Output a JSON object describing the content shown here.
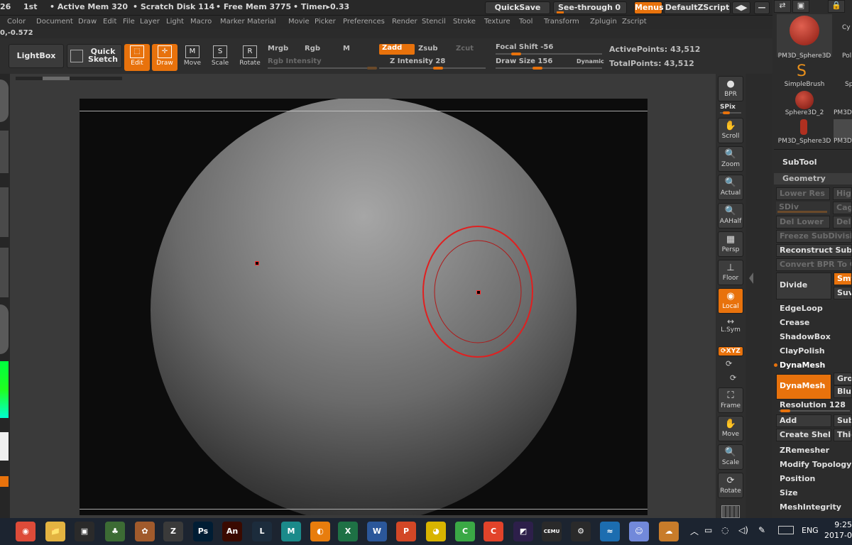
{
  "infobar": {
    "first": "26",
    "first2": "1st",
    "active_mem": "• Active Mem 320",
    "scratch_disk": "• Scratch Disk 114",
    "free_mem": "• Free Mem 3775",
    "timer": "• Timer▸0.33",
    "quicksave": "QuickSave",
    "see_through": "See-through",
    "see_through_value": "0",
    "menus": "Menus",
    "default_zscript": "DefaultZScript"
  },
  "menu": [
    "Color",
    "Document",
    "Draw",
    "Edit",
    "File",
    "Layer",
    "Light",
    "Macro",
    "Marker",
    "Material",
    "Movie",
    "Picker",
    "Preferences",
    "Render",
    "Stencil",
    "Stroke",
    "Texture",
    "Tool",
    "Transform",
    "Zplugin",
    "Zscript"
  ],
  "coords": "0,-0.572",
  "toolbar": {
    "lightbox": "LightBox",
    "quick_sketch": "Quick Sketch",
    "tools": [
      {
        "label": "Edit",
        "glyph": "⬚",
        "active": true
      },
      {
        "label": "Draw",
        "glyph": "✛",
        "active": true
      },
      {
        "label": "Move",
        "glyph": "M",
        "active": false
      },
      {
        "label": "Scale",
        "glyph": "S",
        "active": false
      },
      {
        "label": "Rotate",
        "glyph": "R",
        "active": false
      }
    ],
    "mrgb": "Mrgb",
    "rgb": "Rgb",
    "m": "M",
    "rgb_intensity": "Rgb Intensity",
    "zadd": "Zadd",
    "zsub": "Zsub",
    "zcut": "Zcut",
    "z_intensity": "Z Intensity 28",
    "focal_shift": "Focal Shift -56",
    "draw_size": "Draw Size 156",
    "dynamic": "Dynamic",
    "active_points": "ActivePoints: 43,512",
    "total_points": "TotalPoints: 43,512"
  },
  "right_tools": [
    {
      "label": "BPR",
      "glyph": "●",
      "active": false
    },
    {
      "label": "Scroll",
      "glyph": "✋",
      "active": false
    },
    {
      "label": "Zoom",
      "glyph": "🔍",
      "active": false
    },
    {
      "label": "Actual",
      "glyph": "🔍",
      "active": false
    },
    {
      "label": "AAHalf",
      "glyph": "🔍",
      "active": false
    },
    {
      "label": "Persp",
      "glyph": "▦",
      "active": false
    },
    {
      "label": "Floor",
      "glyph": "⊥",
      "active": false
    },
    {
      "label": "Local",
      "glyph": "◉",
      "active": true
    },
    {
      "label": "L.Sym",
      "glyph": "↔",
      "active": false
    },
    {
      "label": "Frame",
      "glyph": "⛶",
      "active": false
    },
    {
      "label": "Move",
      "glyph": "✋",
      "active": false
    },
    {
      "label": "Scale",
      "glyph": "🔍",
      "active": false
    },
    {
      "label": "Rotate",
      "glyph": "⟳",
      "active": false
    }
  ],
  "spix": "SPix",
  "xyz": "⟳XYZ",
  "right_panel": {
    "thumbs": [
      "PM3D_Sphere3D",
      "SimpleBrush",
      "Sphere3D_2",
      "PM3D_Sphere3D"
    ],
    "side_thumbs": [
      "Cy",
      "Pol",
      "Sp",
      "PM3D",
      "PM3D"
    ],
    "subtool": "SubTool",
    "geometry": "Geometry",
    "lower_res": "Lower Res",
    "higher": "High",
    "sdiv": "SDiv",
    "cage": "Cage",
    "del_lower": "Del Lower",
    "del": "Del",
    "freeze": "Freeze SubDivision",
    "reconstruct": "Reconstruct Subdiv",
    "convert_bpr": "Convert BPR To Geo",
    "divide": "Divide",
    "smt": "Smt",
    "suv": "Suv",
    "edgeloop": "EdgeLoop",
    "crease": "Crease",
    "shadowbox": "ShadowBox",
    "claypolish": "ClayPolish",
    "dynamesh_header": "DynaMesh",
    "dynamesh_btn": "DynaMesh",
    "groups": "Grou",
    "blur": "Blur",
    "resolution": "Resolution 128",
    "add": "Add",
    "sub": "Sub",
    "create_shell": "Create Shell",
    "thick": "Thic",
    "zremesher": "ZRemesher",
    "modify_topology": "Modify Topology",
    "position": "Position",
    "size": "Size",
    "meshintegrity": "MeshIntegrity"
  },
  "taskbar": {
    "apps": [
      {
        "name": "chrome-icon",
        "glyph": "◉",
        "color": "#dd4b39"
      },
      {
        "name": "file-explorer-icon",
        "glyph": "📁",
        "color": "#e3b341"
      },
      {
        "name": "media-icon",
        "glyph": "▣",
        "color": "#2a2a2a"
      },
      {
        "name": "game1-icon",
        "glyph": "♣",
        "color": "#3c6b34"
      },
      {
        "name": "game2-icon",
        "glyph": "✿",
        "color": "#a05a2c"
      },
      {
        "name": "zbrush-icon",
        "glyph": "Z",
        "color": "#3a3a3a"
      },
      {
        "name": "photoshop-icon",
        "glyph": "Ps",
        "color": "#001d34"
      },
      {
        "name": "animate-icon",
        "glyph": "An",
        "color": "#3a0a00"
      },
      {
        "name": "league-icon",
        "glyph": "L",
        "color": "#1c2c3c"
      },
      {
        "name": "maya-icon",
        "glyph": "M",
        "color": "#1b8a8a"
      },
      {
        "name": "blender-icon",
        "glyph": "◐",
        "color": "#e87d0d"
      },
      {
        "name": "excel-icon",
        "glyph": "X",
        "color": "#1e7145"
      },
      {
        "name": "word-icon",
        "glyph": "W",
        "color": "#2b579a"
      },
      {
        "name": "powerpoint-icon",
        "glyph": "P",
        "color": "#d24726"
      },
      {
        "name": "osu-icon",
        "glyph": "◕",
        "color": "#d8b400"
      },
      {
        "name": "camtasia-icon",
        "glyph": "C",
        "color": "#3aa845"
      },
      {
        "name": "app-c-icon",
        "glyph": "C",
        "color": "#e2432a"
      },
      {
        "name": "aftereffects-icon",
        "glyph": "◩",
        "color": "#2d1f4a"
      },
      {
        "name": "cemu-icon",
        "glyph": "CEMU",
        "color": "#2a2a2a"
      },
      {
        "name": "msi-icon",
        "glyph": "⚙",
        "color": "#2a2a2a"
      },
      {
        "name": "dolphin-icon",
        "glyph": "≈",
        "color": "#1c6db0"
      },
      {
        "name": "discord-icon",
        "glyph": "☺",
        "color": "#7289da"
      },
      {
        "name": "onedrive-icon",
        "glyph": "☁",
        "color": "#c87c2a"
      }
    ],
    "lang": "ENG",
    "time": "9:25",
    "date": "2017-0"
  }
}
